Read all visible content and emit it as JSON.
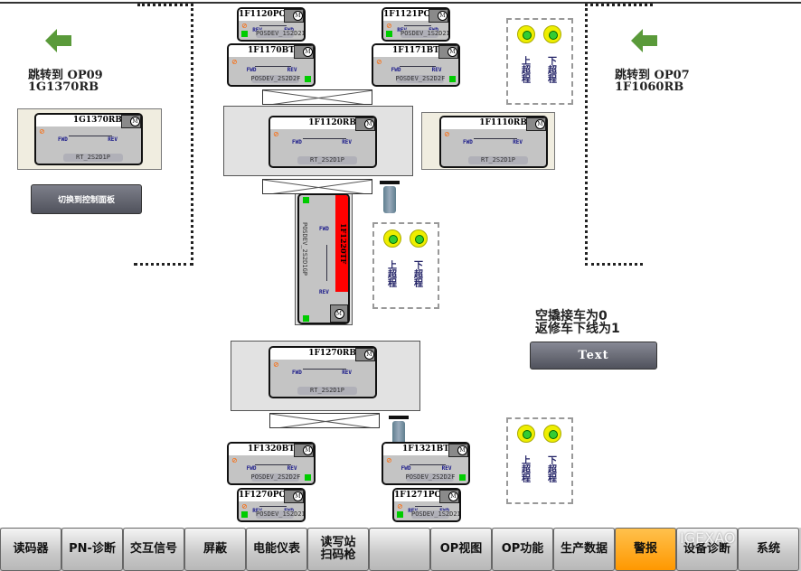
{
  "left_jump": {
    "text": "跳转到 OP09",
    "target": "1G1370RB",
    "panel_button": "切换到控制面板"
  },
  "right_jump": {
    "text": "跳转到 OP07",
    "target": "1F1060RB"
  },
  "devices": [
    {
      "id": "1F1120PO",
      "dev": "POSDEV_1S2D2I",
      "fwd": "FWD",
      "rev": "REV"
    },
    {
      "id": "1F1121PO",
      "dev": "POSDEV_1S2D2I",
      "fwd": "FWD",
      "rev": "REV"
    },
    {
      "id": "1F1170BT",
      "dev": "POSDEV_2S2D2F",
      "fwd": "FWD",
      "rev": "REV"
    },
    {
      "id": "1F1171BT",
      "dev": "POSDEV_2S2D2F",
      "fwd": "FWD",
      "rev": "REV"
    },
    {
      "id": "1F1120RB",
      "dev": "RT_2S2D1P",
      "fwd": "FWD",
      "rev": "REV"
    },
    {
      "id": "1F1110RB",
      "dev": "RT_2S2D1P",
      "fwd": "FWD",
      "rev": "REV"
    },
    {
      "id": "1G1370RB",
      "dev": "RT_2S2D1P",
      "fwd": "FWD",
      "rev": "REV"
    },
    {
      "id": "1F1220TF",
      "dev": "POSDEV_2S2D1GP",
      "fwd": "FWD",
      "rev": "REV"
    },
    {
      "id": "1F1270RB",
      "dev": "RT_2S2D1P",
      "fwd": "FWD",
      "rev": "REV"
    },
    {
      "id": "1F1320BT",
      "dev": "POSDEV_2S2D2F",
      "fwd": "FWD",
      "rev": "REV"
    },
    {
      "id": "1F1321BT",
      "dev": "POSDEV_2S2D2F",
      "fwd": "FWD",
      "rev": "REV"
    },
    {
      "id": "1F1270PO",
      "dev": "POSDEV_1S2D2I",
      "fwd": "FWD",
      "rev": "REV"
    },
    {
      "id": "1F1271PO",
      "dev": "POSDEV_1S2D2I",
      "fwd": "FWD",
      "rev": "REV"
    }
  ],
  "motor_symbol": "M",
  "legend": {
    "up": "上超程",
    "down": "下超程"
  },
  "note": {
    "line1": "空撬接车为0",
    "line2": "返修车下线为1",
    "button": "Text"
  },
  "nav": [
    {
      "label": "读码器"
    },
    {
      "label": "PN-诊断"
    },
    {
      "label": "交互信号"
    },
    {
      "label": "屏蔽"
    },
    {
      "label": "电能仪表"
    },
    {
      "label": "读写站\n扫码枪"
    },
    {
      "label": ""
    },
    {
      "label": "OP视图"
    },
    {
      "label": "OP功能"
    },
    {
      "label": "生产数据"
    },
    {
      "label": "警报",
      "active": true
    },
    {
      "label": "设备诊断"
    },
    {
      "label": "系统"
    }
  ],
  "watermark": "IGEXAO",
  "colors": {
    "active_tab": "#ff9800",
    "fault": "#ff0000",
    "ok": "#00cc00",
    "lamp": "#eeee00",
    "arrow": "#5a9a3a"
  }
}
